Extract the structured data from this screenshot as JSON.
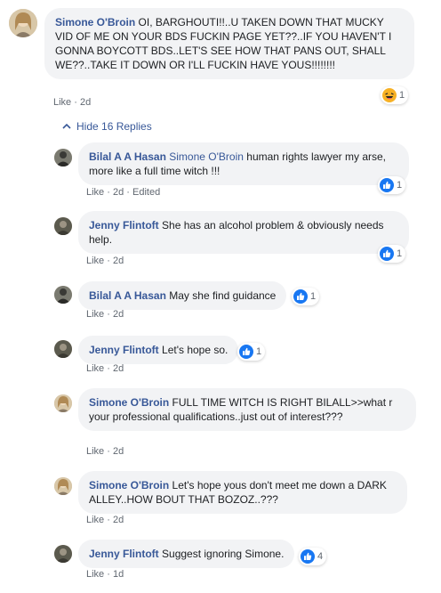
{
  "colors": {
    "link": "#385898",
    "bubble": "#f2f3f5",
    "meta": "#606770",
    "like_blue": "#1877f2",
    "haha_yellow": "#f7b125"
  },
  "comments": [
    {
      "author": "Simone O'Broin",
      "text": "OI, BARGHOUTI!!..U TAKEN DOWN THAT MUCKY VID OF ME ON YOUR BDS FUCKIN PAGE YET??..IF YOU HAVEN'T I GONNA BOYCOTT BDS..LET'S SEE HOW THAT PANS OUT, SHALL WE??..TAKE IT DOWN OR I'LL FUCKIN HAVE YOUS!!!!!!!!",
      "like_label": "Like",
      "sep": "·",
      "time": "2d",
      "reaction_icon": "haha-icon",
      "reaction_count": "1"
    }
  ],
  "hide_replies": {
    "label": "Hide 16 Replies",
    "icon": "chevron-up-icon"
  },
  "replies": [
    {
      "author": "Bilal A A Hasan",
      "mention": "Simone O'Broin",
      "text": "human rights lawyer my arse, more like a full time witch !!!",
      "like_label": "Like",
      "sep": "·",
      "time": "2d",
      "edited": "Edited",
      "reaction_icon": "like-icon",
      "reaction_count": "1"
    },
    {
      "author": "Jenny Flintoft",
      "mention": "",
      "text": "She has an alcohol problem & obviously needs help.",
      "like_label": "Like",
      "sep": "·",
      "time": "2d",
      "edited": "",
      "reaction_icon": "like-icon",
      "reaction_count": "1"
    },
    {
      "author": "Bilal A A Hasan",
      "mention": "",
      "text": "May she find guidance",
      "like_label": "Like",
      "sep": "·",
      "time": "2d",
      "edited": "",
      "reaction_icon": "like-icon",
      "reaction_count": "1"
    },
    {
      "author": "Jenny Flintoft",
      "mention": "",
      "text": "Let's hope so.",
      "like_label": "Like",
      "sep": "·",
      "time": "2d",
      "edited": "",
      "reaction_icon": "like-icon",
      "reaction_count": "1"
    },
    {
      "author": "Simone O'Broin",
      "mention": "",
      "text": "FULL TIME WITCH IS RIGHT BILALL>>what r your professional qualifications..just out of interest???",
      "like_label": "Like",
      "sep": "·",
      "time": "2d",
      "edited": "",
      "reaction_icon": "",
      "reaction_count": ""
    },
    {
      "author": "Simone O'Broin",
      "mention": "",
      "text": "Let's hope yous don't meet me down a DARK ALLEY..HOW BOUT THAT BOZOZ..???",
      "like_label": "Like",
      "sep": "·",
      "time": "2d",
      "edited": "",
      "reaction_icon": "",
      "reaction_count": ""
    },
    {
      "author": "Jenny Flintoft",
      "mention": "",
      "text": "Suggest ignoring Simone.",
      "like_label": "Like",
      "sep": "·",
      "time": "1d",
      "edited": "",
      "reaction_icon": "like-icon",
      "reaction_count": "4"
    }
  ]
}
